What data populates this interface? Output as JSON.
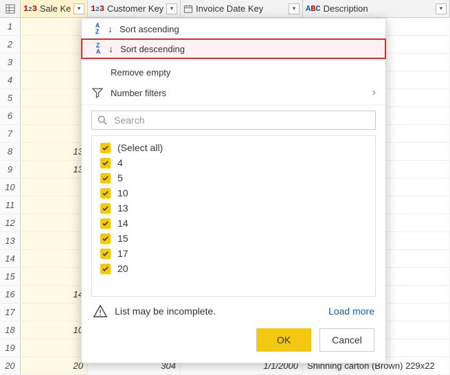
{
  "columns": [
    {
      "name": "Sale Key",
      "type": "number"
    },
    {
      "name": "Customer Key",
      "type": "number"
    },
    {
      "name": "Invoice Date Key",
      "type": "date"
    },
    {
      "name": "Description",
      "type": "text"
    }
  ],
  "selected_column_index": 0,
  "rows": [
    {
      "n": 1,
      "sale": "",
      "cust": "",
      "date": "",
      "desc": "g - inheritance"
    },
    {
      "n": 2,
      "sale": "",
      "cust": "",
      "date": "",
      "desc": "White) 400L"
    },
    {
      "n": 3,
      "sale": "",
      "cust": "",
      "date": "",
      "desc": "e - pizza slice"
    },
    {
      "n": 4,
      "sale": "",
      "cust": "",
      "date": "",
      "desc": "lass with care"
    },
    {
      "n": 5,
      "sale": "",
      "cust": "",
      "date": "",
      "desc": "(Gray) S"
    },
    {
      "n": 6,
      "sale": "",
      "cust": "",
      "date": "",
      "desc": "Pink) M"
    },
    {
      "n": 7,
      "sale": "",
      "cust": "",
      "date": "",
      "desc": "(ML tag t-shir"
    },
    {
      "n": 8,
      "sale": "13",
      "cust": "",
      "date": "",
      "desc": "cket (Blue) S"
    },
    {
      "n": 9,
      "sale": "13",
      "cust": "",
      "date": "",
      "desc": "ware: part of th"
    },
    {
      "n": 10,
      "sale": "",
      "cust": "",
      "date": "",
      "desc": "cket (Blue) M"
    },
    {
      "n": 11,
      "sale": "",
      "cust": "",
      "date": "",
      "desc": "g - (hip, hip, a"
    },
    {
      "n": 12,
      "sale": "",
      "cust": "",
      "date": "",
      "desc": "(ML tag t-shir"
    },
    {
      "n": 13,
      "sale": "",
      "cust": "",
      "date": "",
      "desc": "netal insert bl"
    },
    {
      "n": 14,
      "sale": "",
      "cust": "",
      "date": "",
      "desc": "blades 18mm"
    },
    {
      "n": 15,
      "sale": "",
      "cust": "",
      "date": "",
      "desc": "olue 5mm nib"
    },
    {
      "n": 16,
      "sale": "14",
      "cust": "",
      "date": "",
      "desc": "cket (Blue) S"
    },
    {
      "n": 17,
      "sale": "",
      "cust": "",
      "date": "",
      "desc": "e 48mmx75m"
    },
    {
      "n": 18,
      "sale": "10",
      "cust": "",
      "date": "",
      "desc": "owered slippe"
    },
    {
      "n": 19,
      "sale": "",
      "cust": "",
      "date": "",
      "desc": "(ML tag t-shir"
    },
    {
      "n": 20,
      "sale": "20",
      "cust": "304",
      "date": "1/1/2000",
      "desc": "Shinning carton (Brown) 229x22"
    }
  ],
  "menu": {
    "sort_asc": "Sort ascending",
    "sort_desc": "Sort descending",
    "remove_empty": "Remove empty",
    "number_filters": "Number filters",
    "search_placeholder": "Search",
    "select_all": "(Select all)",
    "values": [
      "4",
      "5",
      "10",
      "13",
      "14",
      "15",
      "17",
      "20"
    ],
    "incomplete": "List may be incomplete.",
    "load_more": "Load more",
    "ok": "OK",
    "cancel": "Cancel"
  }
}
